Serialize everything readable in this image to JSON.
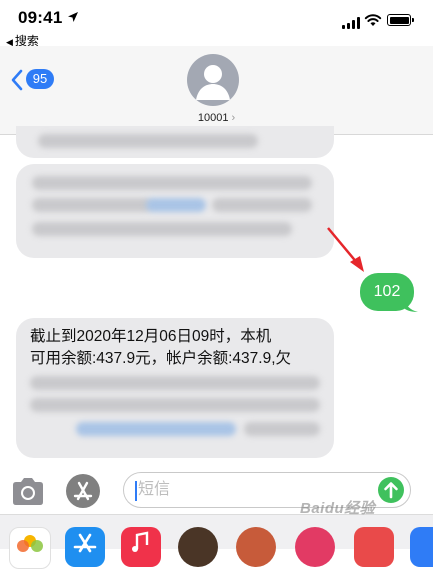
{
  "status_bar": {
    "time": "09:41",
    "back_label": "搜索"
  },
  "header": {
    "unread_count": "95",
    "contact_name": "10001",
    "accent_color": "#2f7cf6"
  },
  "messages": {
    "sent_text": "102",
    "sent_color": "#3fc15d",
    "received_line1": "截止到2020年12月06日09时，本机",
    "received_line2": "可用余额:437.9元，帐户余额:437.9,欠"
  },
  "input": {
    "placeholder": "短信"
  },
  "watermark": "Baidu经验",
  "icons": [
    "location-arrow-icon",
    "signal-icon",
    "wifi-icon",
    "battery-icon",
    "chevron-left-icon",
    "avatar-person-icon",
    "camera-icon",
    "app-store-icon",
    "send-arrow-icon",
    "photos-icon",
    "music-icon",
    "red-arrow-annotation"
  ]
}
